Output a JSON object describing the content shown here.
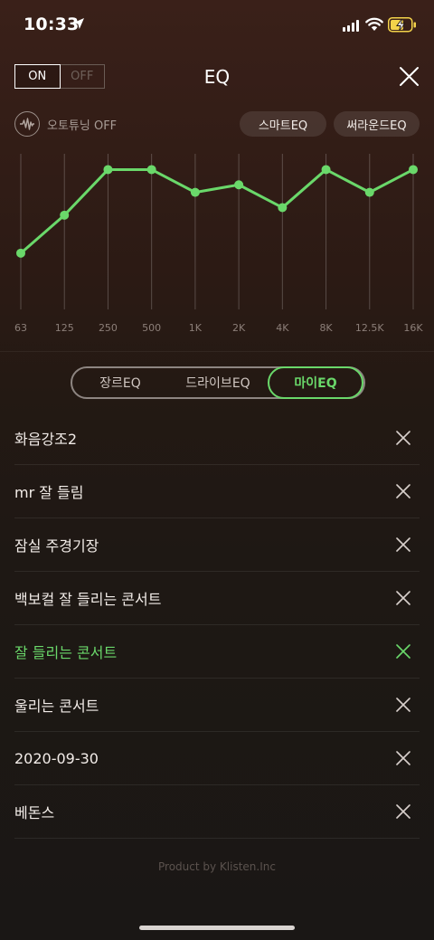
{
  "status_bar": {
    "time": "10:33",
    "icons": [
      "location-arrow-icon",
      "cellular-signal-icon",
      "wifi-icon",
      "battery-charging-icon"
    ]
  },
  "header": {
    "power_on_label": "ON",
    "power_off_label": "OFF",
    "power_state": "ON",
    "title": "EQ",
    "close_icon": "close-icon"
  },
  "options": {
    "autotune_label": "오토튜닝 OFF",
    "autotune_icon": "waveform-icon",
    "smart_eq_label": "스마트EQ",
    "surround_eq_label": "써라운드EQ"
  },
  "eq_graph": {
    "bands": [
      "63",
      "125",
      "250",
      "500",
      "1K",
      "2K",
      "4K",
      "8K",
      "12.5K",
      "16K"
    ],
    "levels": [
      0.37,
      0.62,
      0.92,
      0.92,
      0.77,
      0.82,
      0.67,
      0.92,
      0.77,
      0.92
    ],
    "line_color": "#6ad86a"
  },
  "tabs": [
    {
      "label": "장르EQ",
      "selected": false
    },
    {
      "label": "드라이브EQ",
      "selected": false
    },
    {
      "label": "마이EQ",
      "selected": true
    }
  ],
  "presets": [
    {
      "name": "화음강조2",
      "active": false
    },
    {
      "name": "mr 잘 들림",
      "active": false
    },
    {
      "name": "잠실 주경기장",
      "active": false
    },
    {
      "name": "백보컬 잘 들리는 콘서트",
      "active": false
    },
    {
      "name": "잘 들리는 콘서트",
      "active": true
    },
    {
      "name": "울리는 콘서트",
      "active": false
    },
    {
      "name": "2020-09-30",
      "active": false
    },
    {
      "name": "베돈스",
      "active": false
    }
  ],
  "footer": "Product by Klisten.Inc",
  "colors": {
    "accent_green": "#6ad86a",
    "background_top": "#3a2019",
    "background_bottom": "#1a1715"
  }
}
